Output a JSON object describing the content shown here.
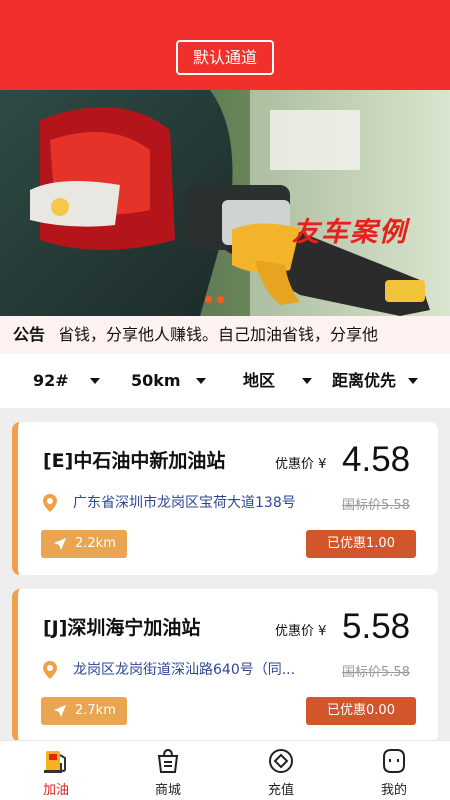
{
  "header": {
    "channel_button": "默认通道"
  },
  "banner": {
    "title": "友车案例"
  },
  "notice": {
    "label": "公告",
    "text": "省钱，分享他人赚钱。自己加油省钱，分享他"
  },
  "filters": [
    {
      "label": "92#"
    },
    {
      "label": "50km"
    },
    {
      "label": "地区"
    },
    {
      "label": "距离优先"
    }
  ],
  "stations": [
    {
      "name": "[E]中石油中新加油站",
      "price_label": "优惠价 ¥",
      "price": "4.58",
      "address": "广东省深圳市龙岗区宝荷大道138号",
      "standard_price": "国标价5.58",
      "distance": "2.2km",
      "discount": "已优惠1.00"
    },
    {
      "name": "[J]深圳海宁加油站",
      "price_label": "优惠价 ¥",
      "price": "5.58",
      "address": "龙岗区龙岗街道深汕路640号（同...",
      "standard_price": "国标价5.58",
      "distance": "2.7km",
      "discount": "已优惠0.00"
    }
  ],
  "tabs": [
    {
      "label": "加油",
      "icon": "fuel-pump-icon",
      "active": true
    },
    {
      "label": "商城",
      "icon": "shopping-bag-icon",
      "active": false
    },
    {
      "label": "充值",
      "icon": "recharge-icon",
      "active": false
    },
    {
      "label": "我的",
      "icon": "profile-icon",
      "active": false
    }
  ],
  "colors": {
    "brand_red": "#f1302b",
    "accent_orange": "#e9a552",
    "discount": "#d2562c",
    "address_blue": "#2f4795"
  }
}
